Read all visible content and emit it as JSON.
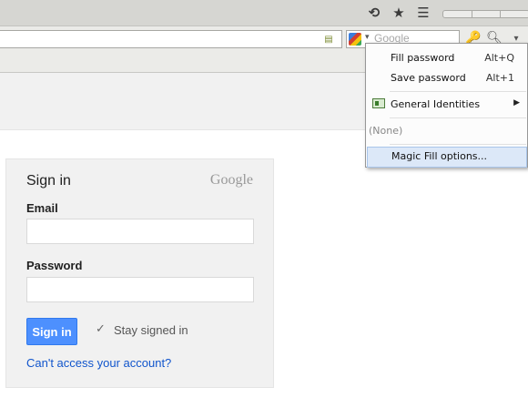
{
  "toolbar": {
    "undo_icon": "undo-arrow-icon",
    "bookmark_icon": "star-icon",
    "menu_icon": "hamburger-menu-icon",
    "search_placeholder": "Google",
    "key_icon": "key-icon",
    "magicfill_icon": "magic-fill-icon"
  },
  "signin": {
    "title": "Sign in",
    "logo_text": "Google",
    "email_label": "Email",
    "email_value": "",
    "password_label": "Password",
    "password_value": "",
    "button_label": "Sign in",
    "stay_signed_in_label": "Stay signed in",
    "stay_signed_in_checked": true,
    "cant_access_link": "Can't access your account?"
  },
  "context_menu": {
    "items": [
      {
        "label": "Fill password",
        "shortcut": "Alt+Q"
      },
      {
        "label": "Save password",
        "shortcut": "Alt+1"
      },
      {
        "label": "General Identities",
        "has_submenu": true
      },
      {
        "label": "(None)"
      },
      {
        "label": "Magic Fill options...",
        "highlighted": true
      }
    ]
  },
  "colors": {
    "signin_button": "#4d90fe",
    "link": "#1155cc",
    "menu_highlight": "#dce8f8"
  }
}
